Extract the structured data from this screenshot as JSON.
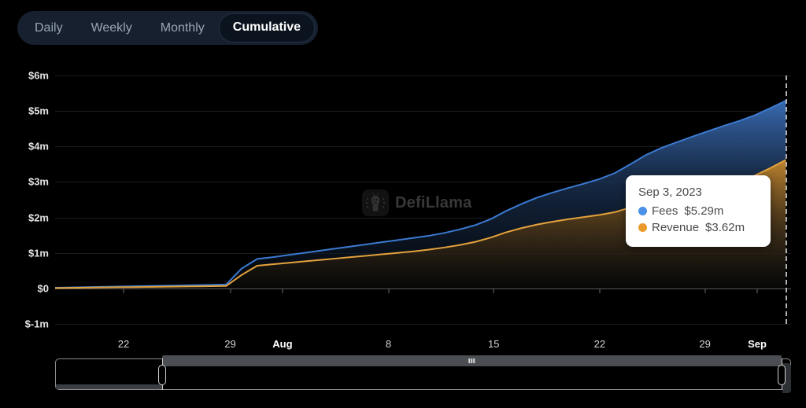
{
  "tabs": [
    {
      "label": "Daily",
      "active": false
    },
    {
      "label": "Weekly",
      "active": false
    },
    {
      "label": "Monthly",
      "active": false
    },
    {
      "label": "Cumulative",
      "active": true
    }
  ],
  "watermark": {
    "text": "DefiLlama",
    "logo_icon": "llama-logo-icon"
  },
  "tooltip": {
    "date": "Sep 3, 2023",
    "rows": [
      {
        "name": "Fees",
        "value": "$5.29m",
        "color": "#4a8fe8"
      },
      {
        "name": "Revenue",
        "value": "$3.62m",
        "color": "#e99a2a"
      }
    ]
  },
  "colors": {
    "fees_line": "#3b7ad1",
    "fees_fill_top": "#3b6fb8",
    "revenue_line": "#e3a23c",
    "revenue_fill_top": "#c78a2e",
    "background": "#000000",
    "grid": "#1c1c1c",
    "axis": "#585858",
    "tab_bar_bg": "#16202e",
    "tab_active_bg": "#0b131e"
  },
  "brush": {
    "selection_start_pct": 14.5,
    "selection_end_pct": 98.7,
    "grip_icon": "drag-grip-icon"
  },
  "chart_data": {
    "type": "area",
    "title": "",
    "xlabel": "",
    "ylabel": "",
    "stacked": false,
    "grid": true,
    "legend": "tooltip",
    "ylim": [
      -1000000,
      6000000
    ],
    "ytick_labels": [
      "$6m",
      "$5m",
      "$4m",
      "$3m",
      "$2m",
      "$1m",
      "$0",
      "$-1m"
    ],
    "ytick_values": [
      6000000,
      5000000,
      4000000,
      3000000,
      2000000,
      1000000,
      0,
      -1000000
    ],
    "xtick_labels": [
      "22",
      "29",
      "Aug",
      "8",
      "15",
      "22",
      "29",
      "Sep"
    ],
    "xtick_bold": [
      false,
      false,
      true,
      false,
      false,
      false,
      false,
      true
    ],
    "xtick_positions_pct": [
      9.3,
      23.8,
      30.9,
      45.3,
      59.6,
      74.0,
      88.3,
      95.4
    ],
    "cursor_x_pct": 99.3,
    "cursor_label": "Sep 3, 2023",
    "x": [
      "Jul 18",
      "Jul 19",
      "Jul 20",
      "Jul 21",
      "Jul 22",
      "Jul 23",
      "Jul 24",
      "Jul 25",
      "Jul 26",
      "Jul 27",
      "Jul 28",
      "Jul 29",
      "Jul 30",
      "Jul 31",
      "Aug 1",
      "Aug 2",
      "Aug 3",
      "Aug 4",
      "Aug 5",
      "Aug 6",
      "Aug 7",
      "Aug 8",
      "Aug 9",
      "Aug 10",
      "Aug 11",
      "Aug 12",
      "Aug 13",
      "Aug 14",
      "Aug 15",
      "Aug 16",
      "Aug 17",
      "Aug 18",
      "Aug 19",
      "Aug 20",
      "Aug 21",
      "Aug 22",
      "Aug 23",
      "Aug 24",
      "Aug 25",
      "Aug 26",
      "Aug 27",
      "Aug 28",
      "Aug 29",
      "Aug 30",
      "Aug 31",
      "Sep 1",
      "Sep 2",
      "Sep 3"
    ],
    "series": [
      {
        "name": "Fees",
        "color": "#3b7ad1",
        "values": [
          20000,
          28000,
          36000,
          44000,
          52000,
          60000,
          68000,
          76000,
          84000,
          92000,
          100000,
          110000,
          560000,
          830000,
          880000,
          940000,
          1000000,
          1060000,
          1120000,
          1180000,
          1240000,
          1300000,
          1360000,
          1420000,
          1480000,
          1560000,
          1660000,
          1780000,
          1950000,
          2180000,
          2380000,
          2560000,
          2700000,
          2830000,
          2950000,
          3080000,
          3250000,
          3500000,
          3760000,
          3960000,
          4120000,
          4280000,
          4430000,
          4580000,
          4720000,
          4880000,
          5080000,
          5290000
        ]
      },
      {
        "name": "Revenue",
        "color": "#e3a23c",
        "values": [
          12000,
          17000,
          22000,
          27000,
          32000,
          37000,
          42000,
          47000,
          52000,
          57000,
          62000,
          68000,
          380000,
          640000,
          680000,
          720000,
          760000,
          800000,
          840000,
          880000,
          920000,
          960000,
          1000000,
          1040000,
          1090000,
          1150000,
          1220000,
          1310000,
          1430000,
          1580000,
          1700000,
          1800000,
          1880000,
          1950000,
          2010000,
          2070000,
          2150000,
          2280000,
          2440000,
          2580000,
          2680000,
          2780000,
          2880000,
          2980000,
          3070000,
          3180000,
          3390000,
          3620000
        ]
      }
    ]
  }
}
